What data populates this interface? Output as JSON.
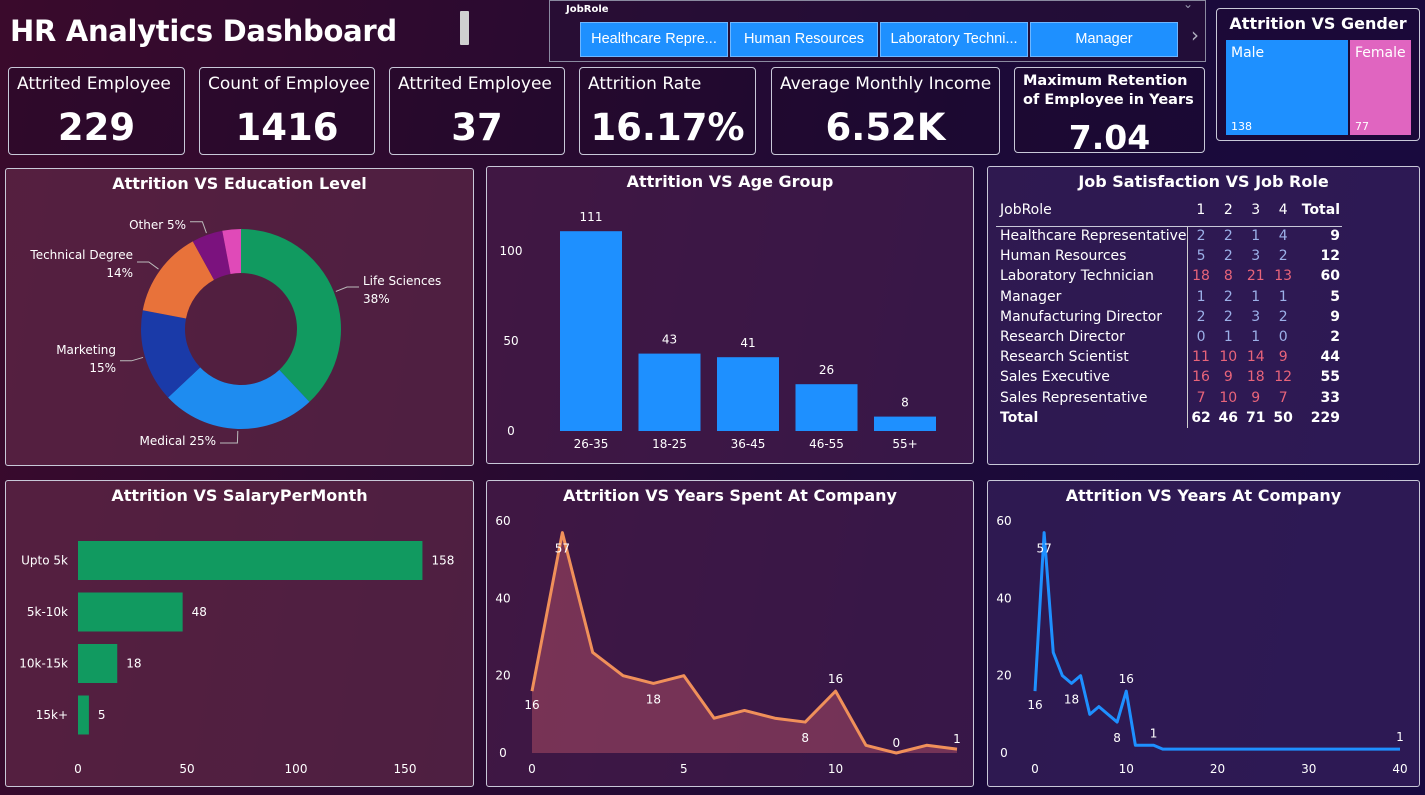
{
  "title": "HR Analytics Dashboard",
  "slicer": {
    "label": "JobRole",
    "items": [
      "Healthcare Repre...",
      "Human Resources",
      "Laboratory Techni...",
      "Manager"
    ]
  },
  "kpis": [
    {
      "label": "Attrited Employee",
      "value": "229"
    },
    {
      "label": "Count of Employee",
      "value": "1416"
    },
    {
      "label": "Attrited Employee",
      "value": "37"
    },
    {
      "label": "Attrition Rate",
      "value": "16.17%"
    },
    {
      "label": "Average Monthly Income",
      "value": "6.52K"
    },
    {
      "label": "Maximum Retention of Employee in Years",
      "value": "7.04"
    }
  ],
  "gender": {
    "title": "Attrition VS Gender",
    "male": {
      "name": "Male",
      "count": "138"
    },
    "female": {
      "name": "Female",
      "count": "77"
    }
  },
  "colors": {
    "blue": "#1e90ff",
    "green": "#119a60",
    "orange": "#e8723a",
    "navy": "#1a3aa8",
    "purple": "#7b127e",
    "pink": "#e04ab8",
    "salmon": "#f0905a",
    "hot": "#e8647a"
  },
  "chart_data": [
    {
      "type": "pie",
      "title": "Attrition VS Education Level",
      "slices": [
        {
          "name": "Life Sciences",
          "value": 38,
          "label": "38%",
          "color": "#119a60"
        },
        {
          "name": "Medical",
          "value": 25,
          "label": "25%",
          "color": "#1e8cf0"
        },
        {
          "name": "Marketing",
          "value": 15,
          "label": "15%",
          "color": "#1a3aa8"
        },
        {
          "name": "Technical Degree",
          "value": 14,
          "label": "14%",
          "color": "#e8723a"
        },
        {
          "name": "Other",
          "value": 5,
          "label": "5%",
          "color": "#7b127e"
        },
        {
          "name": "",
          "value": 3,
          "label": "",
          "color": "#e04ab8"
        }
      ]
    },
    {
      "type": "bar",
      "title": "Attrition VS Age Group",
      "categories": [
        "26-35",
        "18-25",
        "36-45",
        "46-55",
        "55+"
      ],
      "values": [
        111,
        43,
        41,
        26,
        8
      ],
      "yticks": [
        0,
        50,
        100
      ],
      "ylim": [
        0,
        125
      ]
    },
    {
      "type": "table",
      "title": "Job Satisfaction VS Job Role",
      "columns": [
        "JobRole",
        "1",
        "2",
        "3",
        "4",
        "Total"
      ],
      "rows": [
        {
          "role": "Healthcare Representative",
          "v": [
            2,
            2,
            1,
            4
          ],
          "total": 9
        },
        {
          "role": "Human Resources",
          "v": [
            5,
            2,
            3,
            2
          ],
          "total": 12
        },
        {
          "role": "Laboratory Technician",
          "v": [
            18,
            8,
            21,
            13
          ],
          "total": 60
        },
        {
          "role": "Manager",
          "v": [
            1,
            2,
            1,
            1
          ],
          "total": 5
        },
        {
          "role": "Manufacturing Director",
          "v": [
            2,
            2,
            3,
            2
          ],
          "total": 9
        },
        {
          "role": "Research Director",
          "v": [
            0,
            1,
            1,
            0
          ],
          "total": 2
        },
        {
          "role": "Research Scientist",
          "v": [
            11,
            10,
            14,
            9
          ],
          "total": 44
        },
        {
          "role": "Sales Executive",
          "v": [
            16,
            9,
            18,
            12
          ],
          "total": 55
        },
        {
          "role": "Sales Representative",
          "v": [
            7,
            10,
            9,
            7
          ],
          "total": 33
        }
      ],
      "totals": {
        "role": "Total",
        "v": [
          62,
          46,
          71,
          50
        ],
        "total": 229
      }
    },
    {
      "type": "bar",
      "orientation": "horizontal",
      "title": "Attrition VS SalaryPerMonth",
      "categories": [
        "Upto 5k",
        "5k-10k",
        "10k-15k",
        "15k+"
      ],
      "values": [
        158,
        48,
        18,
        5
      ],
      "xticks": [
        0,
        50,
        100,
        150
      ],
      "xlim": [
        0,
        160
      ]
    },
    {
      "type": "area",
      "title": "Attrition VS Years Spent At Company",
      "x": [
        0,
        1,
        2,
        3,
        4,
        5,
        6,
        7,
        8,
        9,
        10,
        11,
        12,
        13,
        14
      ],
      "y": [
        16,
        57,
        26,
        20,
        18,
        20,
        9,
        11,
        9,
        8,
        16,
        2,
        0,
        2,
        1
      ],
      "labels": {
        "0": "16",
        "1": "57",
        "4": "18",
        "9": "8",
        "10": "16",
        "12": "0",
        "14": "1"
      },
      "xticks": [
        0,
        5,
        10
      ],
      "yticks": [
        0,
        20,
        40,
        60
      ],
      "xlim": [
        0,
        14
      ],
      "ylim": [
        0,
        60
      ]
    },
    {
      "type": "line",
      "title": "Attrition VS Years At Company",
      "x": [
        0,
        1,
        2,
        3,
        4,
        5,
        6,
        7,
        8,
        9,
        10,
        11,
        12,
        13,
        14,
        40
      ],
      "y": [
        16,
        57,
        26,
        20,
        18,
        20,
        10,
        12,
        10,
        8,
        16,
        2,
        2,
        2,
        1,
        1
      ],
      "labels": {
        "0": "16",
        "1": "57",
        "4": "18",
        "9": "8",
        "10": "16",
        "13": "1",
        "15": "1"
      },
      "xticks": [
        0,
        10,
        20,
        30,
        40
      ],
      "yticks": [
        0,
        20,
        40,
        60
      ],
      "xlim": [
        0,
        40
      ],
      "ylim": [
        0,
        60
      ]
    }
  ]
}
